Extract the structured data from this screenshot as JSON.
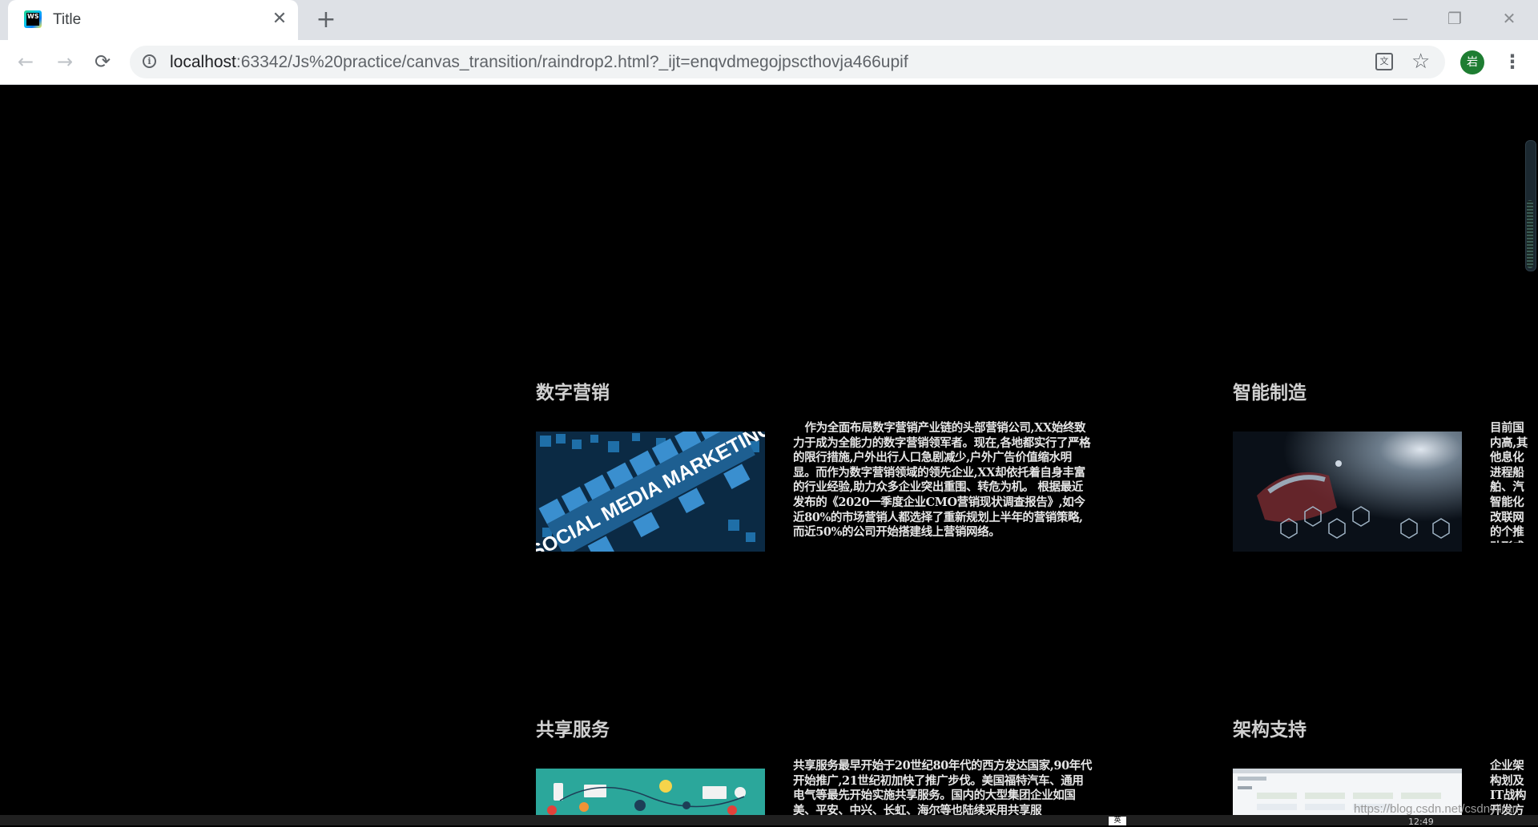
{
  "browser": {
    "tab_title": "Title",
    "favicon_text": "WS",
    "new_tab": "+",
    "close_tab": "✕",
    "url_host": "localhost",
    "url_rest": ":63342/Js%20practice/canvas_transition/raindrop2.html?_ijt=enqvdmegojpscthovja466upif",
    "profile_initial": "岩",
    "window_controls": {
      "minimize": "—",
      "restore": "❐",
      "close": "✕"
    }
  },
  "sections": [
    {
      "title": "数字营销",
      "image_label": "SOCIAL MEDIA MARKETING",
      "text": "作为全面布局数字营销产业链的头部营销公司,XX始终致力于成为全能力的数字营销领军者。现在,各地都实行了严格的限行措施,户外出行人口急剧减少,户外广告价值缩水明显。而作为数字营销领域的领先企业,XX却依托着自身丰富的行业经验,助力众多企业突出重围、转危为机。 根据最近发布的《2020一季度企业CMO营销现状调查报告》,如今近80%的市场营销人都选择了重新规划上半年的营销策略,而近50%的公司开始搭建线上营销网络。"
    },
    {
      "title": "智能制造",
      "text": "目前国内高,其他息化进程船舶、汽智能化改联网的个推动形成方式等。"
    },
    {
      "title": "共享服务",
      "text": "共享服务最早开始于20世纪80年代的西方发达国家,90年代开始推广,21世纪初加快了推广步伐。美国福特汽车、通用电气等最先开始实施共享服务。国内的大型集团企业如国美、平安、中兴、长虹、海尔等也陆续采用共享服"
    },
    {
      "title": "架构支持",
      "text": "企业架构划及IT战构开发方计方法、"
    }
  ],
  "watermark": "https://blog.csdn.net/csdnyiiran",
  "taskbar": {
    "ime": "英",
    "clock": "12:49"
  }
}
